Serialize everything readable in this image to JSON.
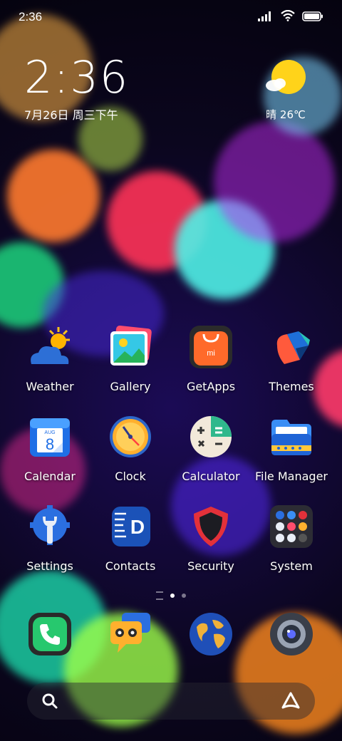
{
  "status_bar": {
    "time": "2:36",
    "icons": [
      "signal-icon",
      "wifi-icon",
      "battery-icon"
    ]
  },
  "clock_widget": {
    "time": "2:36",
    "date": "7月26日 周三下午"
  },
  "weather_widget": {
    "icon": "partly-sunny-icon",
    "text": "晴 26℃"
  },
  "apps": [
    {
      "label": "Weather",
      "icon": "weather-icon"
    },
    {
      "label": "Gallery",
      "icon": "gallery-icon"
    },
    {
      "label": "GetApps",
      "icon": "getapps-icon"
    },
    {
      "label": "Themes",
      "icon": "themes-icon"
    },
    {
      "label": "Calendar",
      "icon": "calendar-icon",
      "calendar_month": "AUG",
      "calendar_day": "8"
    },
    {
      "label": "Clock",
      "icon": "clock-icon"
    },
    {
      "label": "Calculator",
      "icon": "calculator-icon"
    },
    {
      "label": "File Manager",
      "icon": "file-manager-icon"
    },
    {
      "label": "Settings",
      "icon": "settings-icon"
    },
    {
      "label": "Contacts",
      "icon": "contacts-icon"
    },
    {
      "label": "Security",
      "icon": "security-icon"
    },
    {
      "label": "System",
      "icon": "system-folder-icon"
    }
  ],
  "page_indicator": {
    "pages": 2,
    "current": 1
  },
  "dock": [
    {
      "icon": "phone-icon"
    },
    {
      "icon": "messaging-icon"
    },
    {
      "icon": "browser-globe-icon"
    },
    {
      "icon": "camera-icon"
    }
  ],
  "search_bar": {
    "left_icon": "search-icon",
    "right_icon": "assistant-icon"
  },
  "colors": {
    "accent": "#ff6b3d",
    "background": "#1b0b55"
  }
}
